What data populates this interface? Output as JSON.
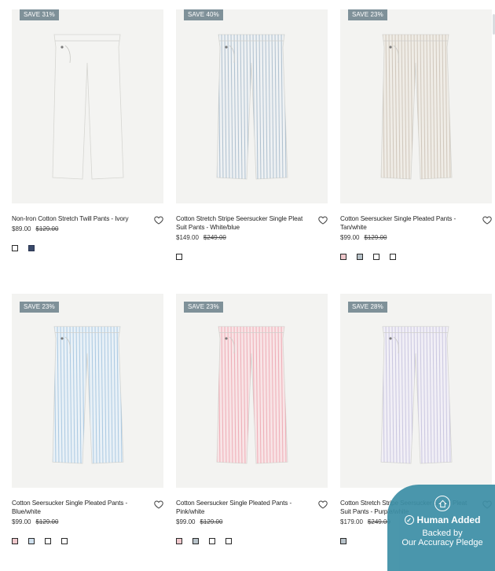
{
  "products": [
    {
      "badge": "SAVE 31%",
      "title": "Non-Iron Cotton Stretch Twill Pants - Ivory",
      "price": "$89.00",
      "old_price": "$129.00",
      "swatches": [
        "white",
        "navy"
      ],
      "pant_color": "#f4f4f2",
      "stripe_color": ""
    },
    {
      "badge": "SAVE 40%",
      "title": "Cotton Stretch Stripe Seersucker Single Pleat Suit Pants - White/blue",
      "price": "$149.00",
      "old_price": "$249.00",
      "swatches": [
        "white"
      ],
      "pant_color": "#eef1f3",
      "stripe_color": "#9fb5c6"
    },
    {
      "badge": "SAVE 23%",
      "title": "Cotton Seersucker Single Pleated Pants - Tan/white",
      "price": "$99.00",
      "old_price": "$129.00",
      "swatches": [
        "pink",
        "grey",
        "white",
        "white"
      ],
      "pant_color": "#efece6",
      "stripe_color": "#c8bfb2"
    },
    {
      "badge": "SAVE 23%",
      "title": "Cotton Seersucker Single Pleated Pants - Blue/white",
      "price": "$99.00",
      "old_price": "$129.00",
      "swatches": [
        "pink",
        "lightblue",
        "white",
        "white"
      ],
      "pant_color": "#e9f1f7",
      "stripe_color": "#9cc0dc"
    },
    {
      "badge": "SAVE 23%",
      "title": "Cotton Seersucker Single Pleated Pants - Pink/white",
      "price": "$99.00",
      "old_price": "$129.00",
      "swatches": [
        "pink",
        "grey",
        "white",
        "white"
      ],
      "pant_color": "#f8e4e6",
      "stripe_color": "#ec9fab"
    },
    {
      "badge": "SAVE 28%",
      "title": "Cotton Stretch Stripe Seersucker Single Pleat Suit Pants - Purple/white",
      "price": "$179.00",
      "old_price": "$249.00",
      "swatches": [
        "grey"
      ],
      "pant_color": "#f1eff6",
      "stripe_color": "#c1bddb"
    }
  ],
  "human_badge": {
    "title": "Human Added",
    "line1": "Backed by",
    "line2": "Our Accuracy Pledge"
  },
  "colors": {
    "badge_bg": "#7f9199",
    "overlay_bg": "#3d8fa6"
  }
}
